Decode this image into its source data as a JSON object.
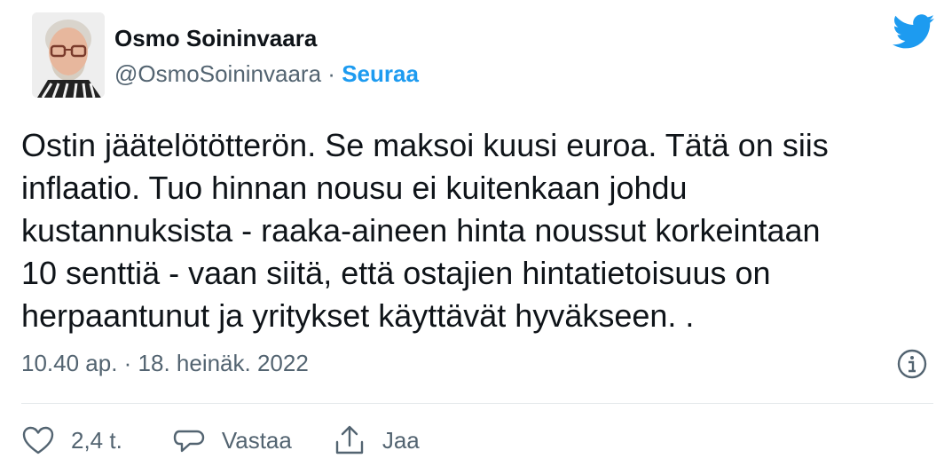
{
  "author": {
    "name": "Osmo Soininvaara",
    "handle": "@OsmoSoininvaara",
    "separator": "·",
    "follow_label": "Seuraa"
  },
  "tweet": {
    "lines": [
      "Ostin jäätelötötterön. Se maksoi kuusi euroa. Tätä on siis",
      "inflaatio. Tuo hinnan nousu ei kuitenkaan johdu",
      "kustannuksista - raaka-aineen hinta noussut korkeintaan",
      "10 senttiä - vaan siitä, että ostajien hintatietoisuus on",
      "herpaantunut ja yritykset käyttävät hyväkseen. ."
    ],
    "timestamp": "10.40 ap. · 18. heinäk. 2022"
  },
  "actions": {
    "like_count": "2,4 t.",
    "reply_label": "Vastaa",
    "share_label": "Jaa"
  },
  "colors": {
    "brand_blue": "#1d9bf0",
    "secondary_text": "#536471",
    "primary_text": "#0f1419"
  },
  "icons": [
    "twitter-bird-icon",
    "info-icon",
    "heart-icon",
    "reply-icon",
    "share-icon"
  ]
}
